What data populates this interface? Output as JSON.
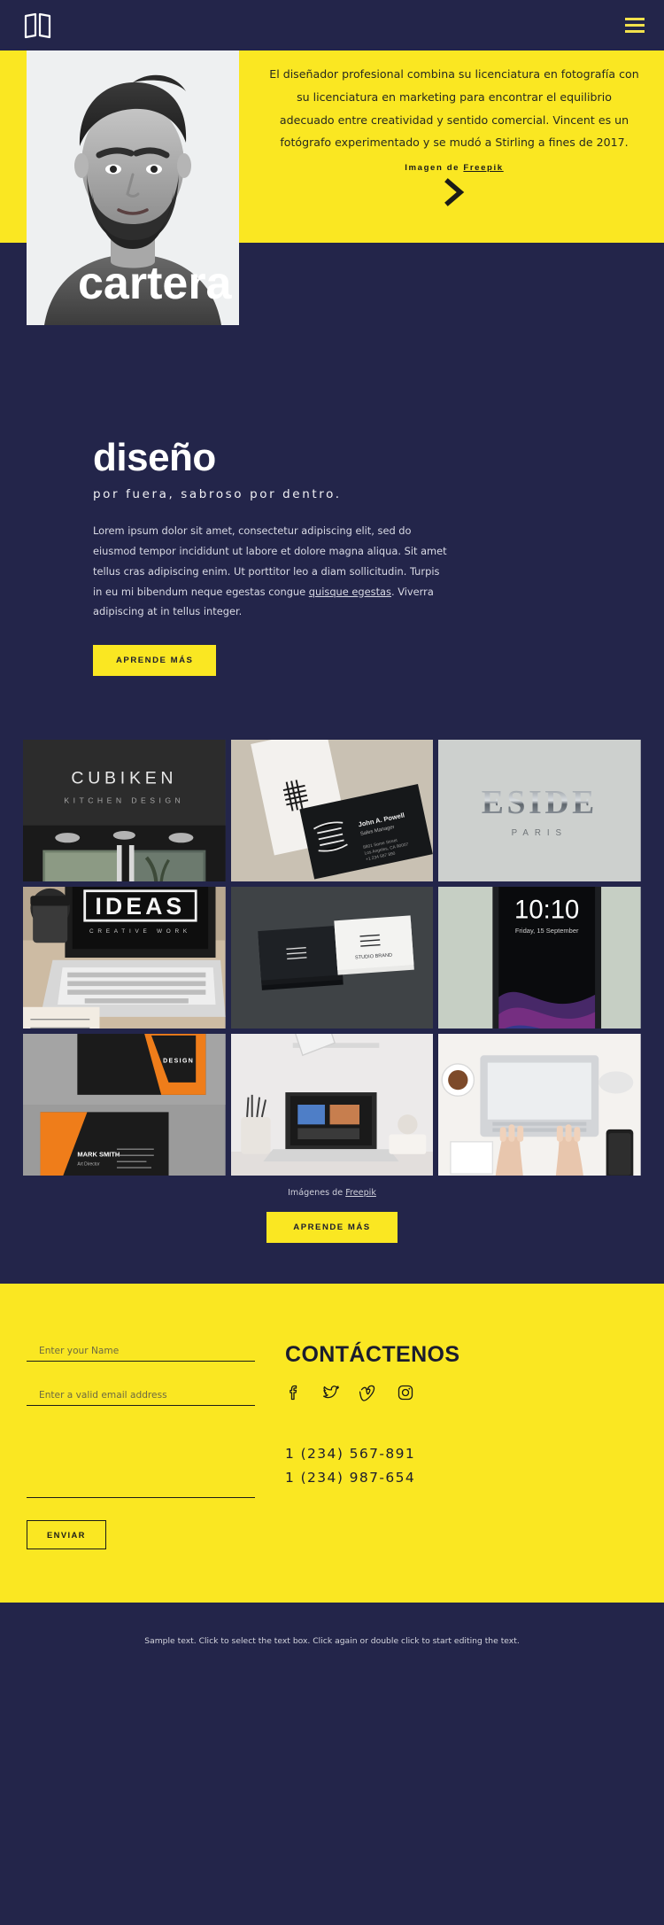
{
  "colors": {
    "navy": "#23254a",
    "yellow": "#fae722",
    "accent_text": "#1b1c2e",
    "menu_icon": "#f2e14c"
  },
  "header": {
    "logo_name": "book-logo-icon",
    "menu_label": "menu"
  },
  "hero": {
    "paragraph": "El diseñador profesional combina su licenciatura en fotografía con su licenciatura en marketing para encontrar el equilibrio adecuado entre creatividad y sentido comercial. Vincent es un fotógrafo experimentado y se mudó a Stirling a fines de 2017.",
    "credit_prefix": "Imagen de ",
    "credit_link": "Freepik",
    "arrow_icon": "chevron-right-icon",
    "portrait_alt": "portrait-photo"
  },
  "cartera": {
    "title": "cartera"
  },
  "design": {
    "heading": "diseño",
    "subheading": "por fuera, sabroso por dentro.",
    "body_part1": "Lorem ipsum dolor sit amet, consectetur adipiscing elit, sed do eiusmod tempor incididunt ut labore et dolore magna aliqua. Sit amet tellus cras adipiscing enim. Ut porttitor leo a diam sollicitudin. Turpis in eu mi bibendum neque egestas congue ",
    "body_link": "quisque egestas",
    "body_part2": ". Viverra adipiscing at in tellus integer.",
    "cta_label": "APRENDE MÁS"
  },
  "gallery": {
    "tiles": [
      {
        "name": "tile-cubiken-storefront",
        "caption": "CUBIKEN",
        "subcaption": "KITCHEN DESIGN"
      },
      {
        "name": "tile-business-cards-dark",
        "caption": "John A. Powell",
        "subcaption": "Sales Manager"
      },
      {
        "name": "tile-eside-paris-sign",
        "caption": "ESIDE",
        "subcaption": "PARIS"
      },
      {
        "name": "tile-ideas-laptop",
        "caption": "IDEAS",
        "subcaption": ""
      },
      {
        "name": "tile-stacked-cards",
        "caption": "",
        "subcaption": ""
      },
      {
        "name": "tile-phone-mockup",
        "caption": "10:10",
        "subcaption": "Friday, 15 September"
      },
      {
        "name": "tile-orange-cards",
        "caption": "DESIGN",
        "subcaption": "MARK SMITH"
      },
      {
        "name": "tile-desk-lamp-laptop",
        "caption": "",
        "subcaption": ""
      },
      {
        "name": "tile-hands-on-laptop",
        "caption": "",
        "subcaption": ""
      }
    ],
    "credit_prefix": "Imágenes de ",
    "credit_link": "Freepik",
    "cta_label": "APRENDE MÁS"
  },
  "contact": {
    "name_placeholder": "Enter your Name",
    "name_value": "",
    "email_placeholder": "Enter a valid email address",
    "email_value": "",
    "message_placeholder": "",
    "message_value": "",
    "submit_label": "ENVIAR",
    "heading": "CONTÁCTENOS",
    "socials": [
      {
        "name": "facebook-icon",
        "label": "Facebook"
      },
      {
        "name": "twitter-icon",
        "label": "Twitter"
      },
      {
        "name": "vimeo-icon",
        "label": "Vimeo"
      },
      {
        "name": "instagram-icon",
        "label": "Instagram"
      }
    ],
    "phone1": "1 (234) 567-891",
    "phone2": "1 (234) 987-654"
  },
  "footer": {
    "text": "Sample text. Click to select the text box. Click again or double click to start editing the text."
  }
}
